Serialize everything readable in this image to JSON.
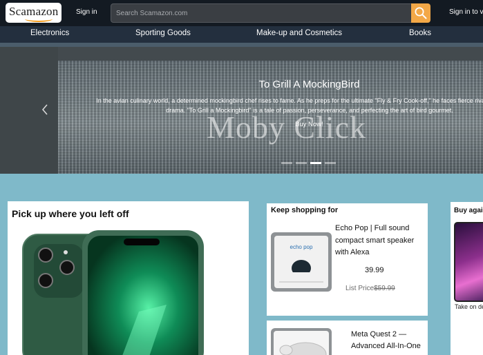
{
  "header": {
    "logo_text": "Scamazon",
    "signin_left": "Sign in",
    "search_placeholder": "Search Scamazon.com",
    "signin_right": "Sign in to vi"
  },
  "categories": [
    "Electronics",
    "Sporting Goods",
    "Make-up and Cosmetics",
    "Books"
  ],
  "hero": {
    "image_text": "Moby Click",
    "title": "To Grill A MockingBird",
    "description": "In the avian culinary world, a determined mockingbird chef rises to fame. As he preps for the ultimate \"Fly & Fry Cook-off,\" he faces fierce rivals and kitchen drama. \"To Grill a Mockingbird\" is a tale of passion, perseverance, and perfecting the art of bird gourmet.",
    "cta": "Buy Now!",
    "slide_count": 4,
    "active_slide": 3
  },
  "cards": {
    "continue": {
      "title": "Pick up where you left off"
    },
    "keep_shopping": {
      "title": "Keep shopping for",
      "product_name": "Echo Pop | Full sound compact smart speaker with Alexa",
      "price": "39.99",
      "list_label": "List Price",
      "list_price": "$59.99",
      "product_image_brand": "echo pop"
    },
    "second_product": {
      "name": "Meta Quest 2 — Advanced All-In-One"
    },
    "buy_again": {
      "title": "Buy again",
      "caption": "Take on de"
    }
  },
  "colors": {
    "topbar": "#131a22",
    "catbar": "#232f3e",
    "page_bg": "#7fb9c9",
    "search_button": "#f3a847",
    "logo_smile": "#f19a1b"
  }
}
